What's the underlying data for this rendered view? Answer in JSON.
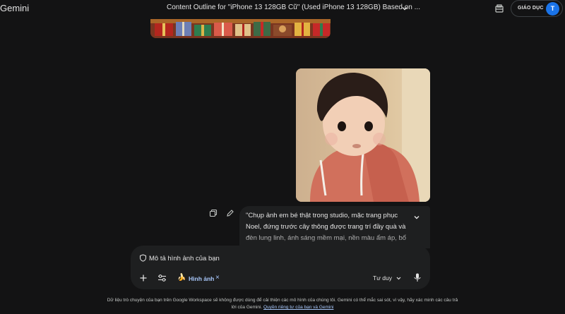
{
  "app": {
    "name": "Gemini"
  },
  "header": {
    "title": "Content Outline for \"iPhone 13 128GB Cũ\" (Used iPhone 13 128GB) Based on ...",
    "workspace_label": "GIÁO DỤC",
    "avatar_initial": "T"
  },
  "message": {
    "prompt_text": "\"Chụp ảnh em bé thật trong studio, mặc trang phục Noel, đứng trước cây thông được trang trí đầy quà và đèn lung linh, ánh sáng mềm mại, nền màu ấm áp, bố"
  },
  "input": {
    "prompt_chip": "Mô tả hình ảnh của bạn",
    "image_tool_label": "Hình ảnh",
    "image_tool_icon": "🍌",
    "mode_label": "Tư duy"
  },
  "footer": {
    "disclaimer": "Dữ liệu trò chuyện của bạn trên Google Workspace sẽ không được dùng để cải thiện các mô hình của chúng tôi. Gemini có thể mắc sai sót, vì vậy, hãy xác minh các câu trả lời của Gemini.",
    "privacy_link": "Quyền riêng tư của bạn và Gemini"
  },
  "colors": {
    "background": "#131314",
    "surface": "#1e1f20",
    "accent_link": "#a8c7fa",
    "avatar": "#1a73e8"
  },
  "icons": [
    "chevron-down-icon",
    "toolbox-icon",
    "copy-icon",
    "edit-icon",
    "shield-icon",
    "plus-icon",
    "tools-icon",
    "banana-icon",
    "close-icon",
    "mic-icon"
  ]
}
